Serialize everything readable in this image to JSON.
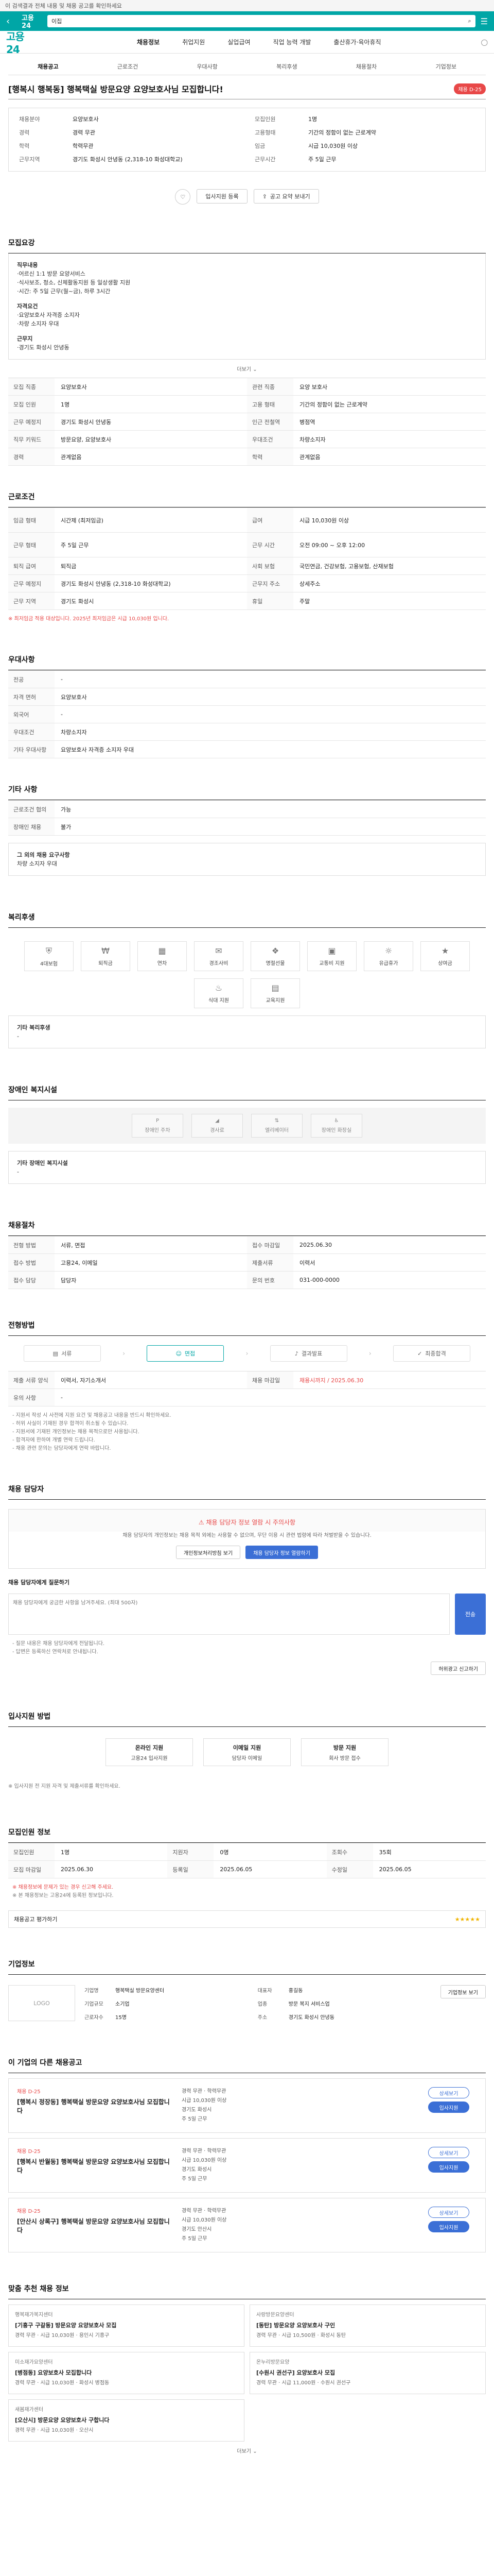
{
  "banner": {
    "text": "이 검색결과 전체 내용 및 채용 공고를 확인하세요"
  },
  "header": {
    "logo": "고용24",
    "search_placeholder": "키워드를 입력하세요",
    "search_value": "이집"
  },
  "nav": {
    "brand": "고용24",
    "links": [
      "채용정보",
      "취업지원",
      "실업급여",
      "직업 능력 개발",
      "출산휴가·육아휴직"
    ]
  },
  "tabs": [
    "채용공고",
    "근로조건",
    "우대사항",
    "복리후생",
    "채용절차",
    "기업정보"
  ],
  "title": "[행복시 행복동] 행복택실 방문요양 요양보호사님 모집합니다!",
  "title_badge": "채용 D-25",
  "info": [
    {
      "k": "채용분야",
      "v": "요양보호사"
    },
    {
      "k": "모집인원",
      "v": "1명"
    },
    {
      "k": "경력",
      "v": "경력 무관"
    },
    {
      "k": "고용형태",
      "v": "기간의 정함이 없는 근로계약"
    },
    {
      "k": "학력",
      "v": "학력무관"
    },
    {
      "k": "임금",
      "v": "시급 10,030원 이상"
    },
    {
      "k": "근무지역",
      "v": "경기도 화성시 안녕동 (2,318-10 화성대학교)"
    },
    {
      "k": "근무시간",
      "v": "주 5일 근무"
    }
  ],
  "actions": {
    "apply": "입사지원 등록",
    "scrap": "스크랩",
    "share": "공고 요약 보내기"
  },
  "recruit_section": {
    "title": "모집요강",
    "intro_label": "직무내용",
    "body": [
      "직무내용",
      "·어르신 1:1 방문 요양서비스",
      "·식사보조, 청소, 신체활동지원 등 일상생활 지원",
      "·시간: 주 5일 근무(월~금), 하루 3시간",
      "",
      "자격요건",
      "·요양보호사 자격증 소지자",
      "·차량 소지자 우대",
      "",
      "근무지",
      "·경기도 화성시 안녕동"
    ],
    "more": "더보기"
  },
  "job_rows": [
    [
      "모집 직종",
      "요양보호사",
      "관련 직종",
      "요양 보호사"
    ],
    [
      "모집 인원",
      "1명",
      "고용 형태",
      "기간의 정함이 없는 근로계약"
    ],
    [
      "근무 예정지",
      "경기도 화성시 안녕동",
      "인근 전철역",
      "병점역"
    ],
    [
      "직무 키워드",
      "방문요양, 요양보호사",
      "우대조건",
      "차량소지자"
    ],
    [
      "경력",
      "관계없음",
      "학력",
      "관계없음"
    ]
  ],
  "condition_section": {
    "title": "근로조건",
    "rows": [
      [
        "임금 형태",
        "시간제 (최저임금)",
        "급여",
        "시급 10,030원 이상"
      ],
      [
        "근무 형태",
        "주 5일 근무",
        "근무 시간",
        "오전 09:00 ~ 오후 12:00"
      ],
      [
        "퇴직 급여",
        "퇴직금",
        "사회 보험",
        "국민연금, 건강보험, 고용보험, 산재보험"
      ],
      [
        "근무 예정지",
        "경기도 화성시 안녕동 (2,318-10 화성대학교)",
        "근무지 주소",
        "상세주소"
      ],
      [
        "근무 지역",
        "경기도 화성시",
        "휴일",
        "주말"
      ]
    ],
    "note": "※ 최저임금 적용 대상입니다. 2025년 최저임금은 시급 10,030원 입니다."
  },
  "preference_section": {
    "title": "우대사항",
    "rows": [
      [
        "전공",
        "-"
      ],
      [
        "자격 면허",
        "요양보호사"
      ],
      [
        "외국어",
        "-"
      ],
      [
        "우대조건",
        "차량소지자"
      ],
      [
        "기타 우대사항",
        "요양보호사 자격증 소지자 우대"
      ]
    ]
  },
  "other_section": {
    "title": "기타 사항",
    "rows": [
      [
        "근로조건 협의",
        "가능"
      ],
      [
        "장애인 채용",
        "불가"
      ]
    ],
    "extra_label": "그 외의 채용 요구사항",
    "extra": "차량 소지자 우대"
  },
  "welfare_section": {
    "title": "복리후생",
    "items": [
      "4대보험",
      "퇴직금",
      "연차",
      "경조사비",
      "명절선물",
      "교통비 지원",
      "유급휴가",
      "상여금",
      "식대 지원",
      "교육지원"
    ],
    "other_label": "기타 복리후생",
    "other": "-"
  },
  "disabled_section": {
    "title": "장애인 복지시설",
    "items": [
      "장애인 주차",
      "경사로",
      "엘리베이터",
      "장애인 화장실"
    ],
    "other_label": "기타 장애인 복지시설",
    "other": "-"
  },
  "process_section": {
    "title": "채용절차",
    "rows": [
      [
        "전형 방법",
        "서류, 면접",
        "접수 마감일",
        "2025.06.30"
      ],
      [
        "접수 방법",
        "고용24, 이메일",
        "제출서류",
        "이력서"
      ],
      [
        "접수 담당",
        "담당자",
        "문의 번호",
        "031-000-0000"
      ]
    ]
  },
  "steps_section": {
    "title": "전형방법",
    "steps": [
      "서류",
      "면접",
      "결과발표",
      "최종합격"
    ],
    "doc_label": "제출 서류 양식",
    "doc_value": "이력서, 자기소개서",
    "apply_label": "채용 마감일",
    "apply_value": "채용시까지 / 2025.06.30",
    "note_label": "유의 사항",
    "note_value": "-",
    "notes": [
      "- 지원서 작성 시 사전에 지원 요건 및 채용공고 내용을 반드시 확인하세요.",
      "- 허위 사실이 기재된 경우 합격이 취소될 수 있습니다.",
      "- 지원서에 기재된 개인정보는 채용 목적으로만 사용됩니다.",
      "- 합격자에 한하여 개별 연락 드립니다.",
      "- 채용 관련 문의는 담당자에게 연락 바랍니다."
    ]
  },
  "contact_section": {
    "title": "채용 담당자",
    "notice": "채용 담당자 정보 열람 시 주의사항",
    "desc": "채용 담당자의 개인정보는 채용 목적 외에는 사용할 수 없으며, 무단 이용 시 관련 법령에 따라 처벌받을 수 있습니다.",
    "btn1": "개인정보처리방침 보기",
    "btn2": "채용 담당자 정보 열람하기",
    "inquiry_label": "채용 담당자에게 질문하기",
    "inquiry_placeholder": "채용 담당자에게 궁금한 사항을 남겨주세요. (최대 500자)",
    "send": "전송",
    "notes": [
      "- 질문 내용은 채용 담당자에게 전달됩니다.",
      "- 답변은 등록하신 연락처로 안내됩니다."
    ],
    "report": "허위광고 신고하기"
  },
  "howto_section": {
    "title": "입사지원 방법",
    "items": [
      {
        "label": "온라인 지원",
        "desc": "고용24 입사지원"
      },
      {
        "label": "이메일 지원",
        "desc": "담당자 이메일"
      },
      {
        "label": "방문 지원",
        "desc": "회사 방문 접수"
      }
    ],
    "note": "※ 입사지원 전 지원 자격 및 제출서류를 확인하세요."
  },
  "summary_section": {
    "title": "모집인원 정보",
    "rows": [
      [
        "모집인원",
        "1명",
        "지원자",
        "0명",
        "조회수",
        "35회"
      ],
      [
        "모집 마감일",
        "2025.06.30",
        "등록일",
        "2025.06.05",
        "수정일",
        "2025.06.05"
      ]
    ],
    "notes": [
      "※ 채용정보에 문제가 있는 경우 신고해 주세요.",
      "※ 본 채용정보는 고용24에 등록된 정보입니다."
    ],
    "rating": "채용공고 평가하기"
  },
  "company_section": {
    "title": "기업정보",
    "logo": "LOGO",
    "name_label": "기업명",
    "name": "행복택실 방문요양센터",
    "rep_label": "대표자",
    "rep": "홍길동",
    "size_label": "기업규모",
    "size": "소기업",
    "industry_label": "업종",
    "industry": "방문 복지 서비스업",
    "emp_label": "근로자수",
    "emp": "15명",
    "addr_label": "주소",
    "addr": "경기도 화성시 안녕동",
    "more": "기업정보 보기"
  },
  "same_company": {
    "title": "이 기업의 다른 채용공고",
    "jobs": [
      {
        "tag": "채용 D-25",
        "title": "[행복시 정장동] 행복택실 방문요양 요양보호사님 모집합니다",
        "meta": [
          "경력 무관 · 학력무관",
          "시급 10,030원 이상",
          "경기도 화성시",
          "주 5일 근무"
        ]
      },
      {
        "tag": "채용 D-25",
        "title": "[행복시 반월동] 행복택실 방문요양 요양보호사님 모집합니다",
        "meta": [
          "경력 무관 · 학력무관",
          "시급 10,030원 이상",
          "경기도 화성시",
          "주 5일 근무"
        ]
      },
      {
        "tag": "채용 D-25",
        "title": "[안산시 상록구] 행복택실 방문요양 요양보호사님 모집합니다",
        "meta": [
          "경력 무관 · 학력무관",
          "시급 10,030원 이상",
          "경기도 안산시",
          "주 5일 근무"
        ]
      }
    ],
    "btn_detail": "상세보기",
    "btn_apply": "입사지원"
  },
  "recommend": {
    "title": "맞춤 추천 채용 정보",
    "items": [
      {
        "org": "행복재가복지센터",
        "title": "[기흥구 구갈동] 방문요양 요양보호사 모집",
        "meta": [
          "경력 무관",
          "시급 10,030원",
          "용인시 기흥구"
        ]
      },
      {
        "org": "사랑방문요양센터",
        "title": "[동탄] 방문요양 요양보호사 구인",
        "meta": [
          "경력 무관",
          "시급 10,500원",
          "화성시 동탄"
        ]
      },
      {
        "org": "미소재가요양센터",
        "title": "[병점동] 요양보호사 모집합니다",
        "meta": [
          "경력 무관",
          "시급 10,030원",
          "화성시 병점동"
        ]
      },
      {
        "org": "온누리방문요양",
        "title": "[수원시 권선구] 요양보호사 모집",
        "meta": [
          "경력 무관",
          "시급 11,000원",
          "수원시 권선구"
        ]
      },
      {
        "org": "새봄재가센터",
        "title": "[오산시] 방문요양 요양보호사 구합니다",
        "meta": [
          "경력 무관",
          "시급 10,030원",
          "오산시"
        ]
      }
    ],
    "more": "더보기"
  }
}
